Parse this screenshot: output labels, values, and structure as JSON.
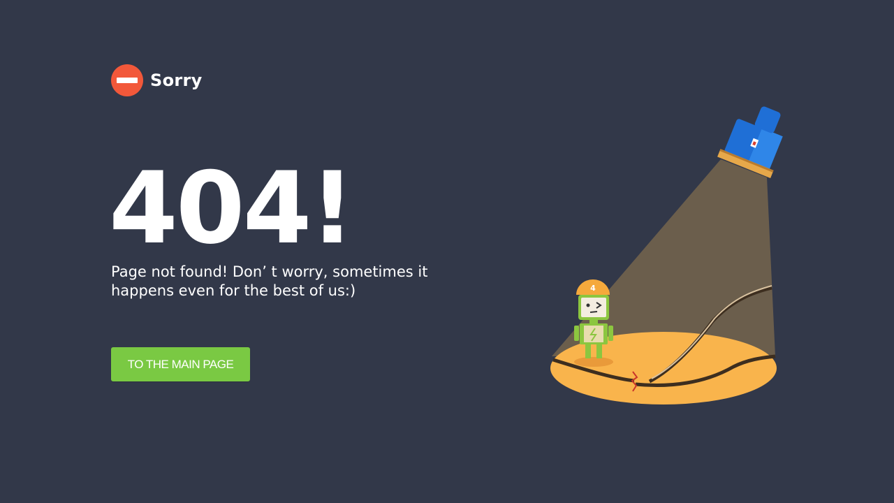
{
  "header": {
    "icon": "no-entry-icon",
    "title": "Sorry"
  },
  "error": {
    "code": "404!",
    "message": "Page not found! Don’ t worry, sometimes it happens even for the best of us:)"
  },
  "actions": {
    "main_page_label": "TO THE MAIN PAGE"
  },
  "illustration": {
    "description_icons": [
      "flashlight-icon",
      "robot-icon",
      "broken-cable-icon"
    ],
    "robot_badge": "4"
  },
  "colors": {
    "background": "#323849",
    "accent_red": "#f2583a",
    "button_green": "#7ac943",
    "spot_orange": "#f9b44c",
    "beam": "#6b5e4c",
    "flashlight_blue": "#1f6fd6"
  }
}
